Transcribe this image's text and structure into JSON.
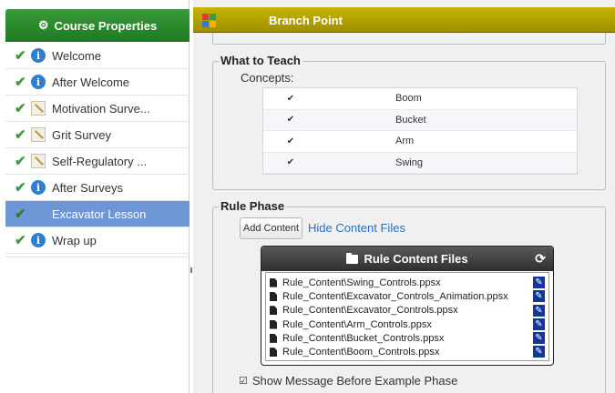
{
  "sidebar": {
    "header": "Course Properties",
    "items": [
      {
        "label": "Welcome",
        "icon": "info-icon"
      },
      {
        "label": "After Welcome",
        "icon": "info-icon"
      },
      {
        "label": "Motivation Surve...",
        "icon": "survey-icon"
      },
      {
        "label": "Grit Survey",
        "icon": "survey-icon"
      },
      {
        "label": "Self-Regulatory ...",
        "icon": "survey-icon"
      },
      {
        "label": "After Surveys",
        "icon": "info-icon"
      },
      {
        "label": "Excavator Lesson",
        "icon": "branch-grid-icon",
        "selected": true
      },
      {
        "label": "Wrap up",
        "icon": "info-icon"
      }
    ]
  },
  "main": {
    "title": "Branch Point",
    "teach": {
      "legend": "What to Teach",
      "concepts_label": "Concepts:",
      "concepts": [
        "Boom",
        "Bucket",
        "Arm",
        "Swing"
      ]
    },
    "rule": {
      "legend": "Rule Phase",
      "add_button": "Add Content",
      "hide_link": "Hide Content Files",
      "files_title": "Rule Content Files",
      "files": [
        "Rule_Content\\Swing_Controls.ppsx",
        "Rule_Content\\Excavator_Controls_Animation.ppsx",
        "Rule_Content\\Excavator_Controls.ppsx",
        "Rule_Content\\Arm_Controls.ppsx",
        "Rule_Content\\Bucket_Controls.ppsx",
        "Rule_Content\\Boom_Controls.ppsx"
      ],
      "show_message": "Show Message Before Example Phase"
    }
  },
  "colors": {
    "sidebar_header": "#2a8a2e",
    "main_header": "#b5a300",
    "selected_item": "#6d96d6",
    "link": "#2a6fb8"
  }
}
